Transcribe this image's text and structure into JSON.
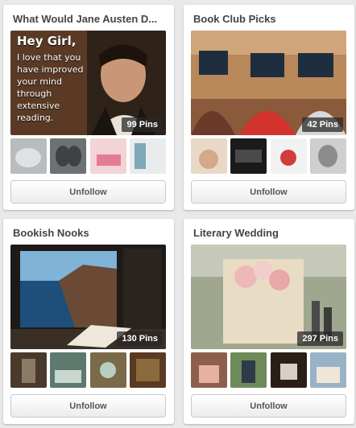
{
  "boards": [
    {
      "title": "What Would Jane Austen D...",
      "pins": "99 Pins",
      "cover_text_head": "Hey Girl,",
      "cover_text_lines": [
        "I love that you",
        "have improved",
        "your mind",
        "through",
        "extensive",
        "reading."
      ],
      "button": "Unfollow"
    },
    {
      "title": "Book Club Picks",
      "pins": "42 Pins",
      "button": "Unfollow"
    },
    {
      "title": "Bookish Nooks",
      "pins": "130 Pins",
      "button": "Unfollow"
    },
    {
      "title": "Literary Wedding",
      "pins": "297 Pins",
      "button": "Unfollow"
    }
  ]
}
